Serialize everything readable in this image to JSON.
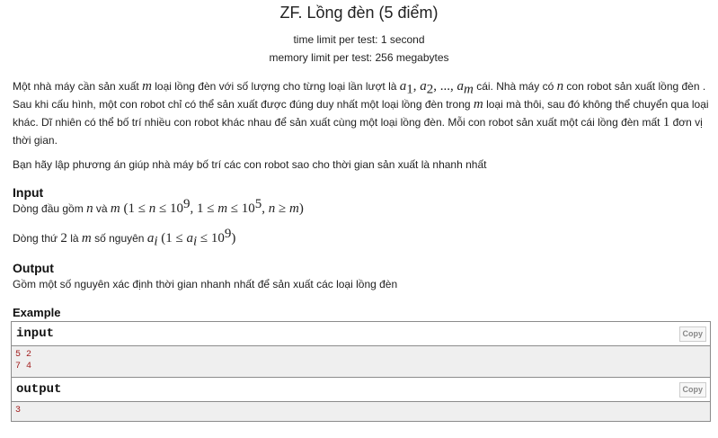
{
  "problem": {
    "title": "ZF. Lồng đèn (5 điểm)",
    "time_limit": "time limit per test: 1 second",
    "memory_limit": "memory limit per test: 256 megabytes"
  },
  "statement": {
    "p1_a": "Một nhà máy cần sản xuất ",
    "p1_m": "m",
    "p1_b": " loại lồng đèn với số lượng cho từng loại lần lượt là ",
    "p1_a1": "a",
    "p1_sub1": "1",
    "p1_comma1": ", ",
    "p1_a2": "a",
    "p1_sub2": "2",
    "p1_dots": ", ..., ",
    "p1_am": "a",
    "p1_subm": "m",
    "p1_c": " cái. Nhà máy có ",
    "p1_n": "n",
    "p1_d": " con robot sản xuất lồng đèn . Sau khi cấu hình, một con robot chỉ có thể sản xuất được đúng duy nhất một loại lồng đèn trong ",
    "p1_m2": "m",
    "p1_e": " loại mà thôi, sau đó không thể chuyển qua loại khác. Dĩ nhiên có thể bố trí nhiều con robot khác nhau để sản xuất cùng một loại lồng đèn. Mỗi con robot sản xuất một cái lồng đèn mất ",
    "p1_one": "1",
    "p1_f": " đơn vị thời gian.",
    "p2": "Bạn hãy lập phương án giúp nhà máy bố trí các con robot sao cho thời gian sản xuất là nhanh nhất"
  },
  "input_section": {
    "heading": "Input",
    "l1_a": "Dòng đầu gồm ",
    "l1_n": "n",
    "l1_b": " và ",
    "l1_m": "m",
    "l1_c1": " (1 ≤ ",
    "l1_n2": "n",
    "l1_c2": " ≤ 10",
    "l1_e9": "9",
    "l1_c3": ", 1 ≤ ",
    "l1_m2": "m",
    "l1_c4": " ≤ 10",
    "l1_e5": "5",
    "l1_c5": ", ",
    "l1_n3": "n",
    "l1_c6": " ≥ ",
    "l1_m3": "m",
    "l1_c7": ")",
    "l2_a": "Dòng thứ ",
    "l2_two": "2",
    "l2_b": " là ",
    "l2_m": "m",
    "l2_c": " số nguyên ",
    "l2_a_i": "a",
    "l2_sub_i": "i",
    "l2_d1": " (1 ≤ ",
    "l2_a_i2": "a",
    "l2_sub_i2": "i",
    "l2_d2": " ≤ 10",
    "l2_e9": "9",
    "l2_d3": ")"
  },
  "output_section": {
    "heading": "Output",
    "text": "Gồm một số nguyên xác định thời gian nhanh nhất để sản xuất các loại lồng đèn"
  },
  "example": {
    "heading": "Example",
    "input_label": "input",
    "input_lines": "5 2\n7 4",
    "output_label": "output",
    "output_lines": "3",
    "copy_label": "Copy"
  }
}
